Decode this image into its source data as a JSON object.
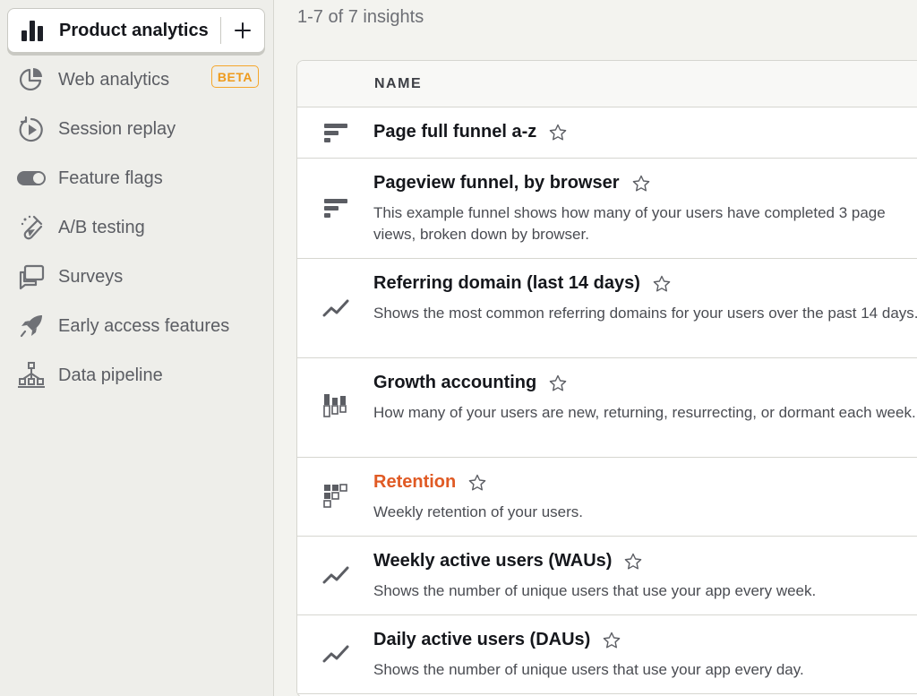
{
  "sidebar": {
    "active": {
      "label": "Product analytics",
      "icon": "bar-chart-icon",
      "add_icon": "plus-icon"
    },
    "items": [
      {
        "label": "Web analytics",
        "icon": "pie-chart-icon",
        "badge": "BETA"
      },
      {
        "label": "Session replay",
        "icon": "replay-icon"
      },
      {
        "label": "Feature flags",
        "icon": "toggle-icon"
      },
      {
        "label": "A/B testing",
        "icon": "flask-icon"
      },
      {
        "label": "Surveys",
        "icon": "chat-bubbles-icon"
      },
      {
        "label": "Early access features",
        "icon": "rocket-icon"
      },
      {
        "label": "Data pipeline",
        "icon": "pipeline-icon"
      }
    ]
  },
  "main": {
    "count_text": "1-7 of 7 insights",
    "column_header": "NAME",
    "rows": [
      {
        "title": "Page full funnel a-z",
        "description": "",
        "icon": "funnel-icon"
      },
      {
        "title": "Pageview funnel, by browser",
        "description": "This example funnel shows how many of your users have completed 3 page views, broken down by browser.",
        "icon": "funnel-icon"
      },
      {
        "title": "Referring domain (last 14 days)",
        "description": "Shows the most common referring domains for your users over the past 14 days.",
        "icon": "trend-line-icon"
      },
      {
        "title": "Growth accounting",
        "description": "How many of your users are new, returning, resurrecting, or dormant each week.",
        "icon": "stacked-bars-icon"
      },
      {
        "title": "Retention",
        "description": "Weekly retention of your users.",
        "icon": "retention-grid-icon"
      },
      {
        "title": "Weekly active users (WAUs)",
        "description": "Shows the number of unique users that use your app every week.",
        "icon": "trend-line-icon"
      },
      {
        "title": "Daily active users (DAUs)",
        "description": "Shows the number of unique users that use your app every day.",
        "icon": "trend-line-icon"
      }
    ]
  },
  "colors": {
    "accent": "#e05a24",
    "beta_badge": "#f5a62b"
  }
}
